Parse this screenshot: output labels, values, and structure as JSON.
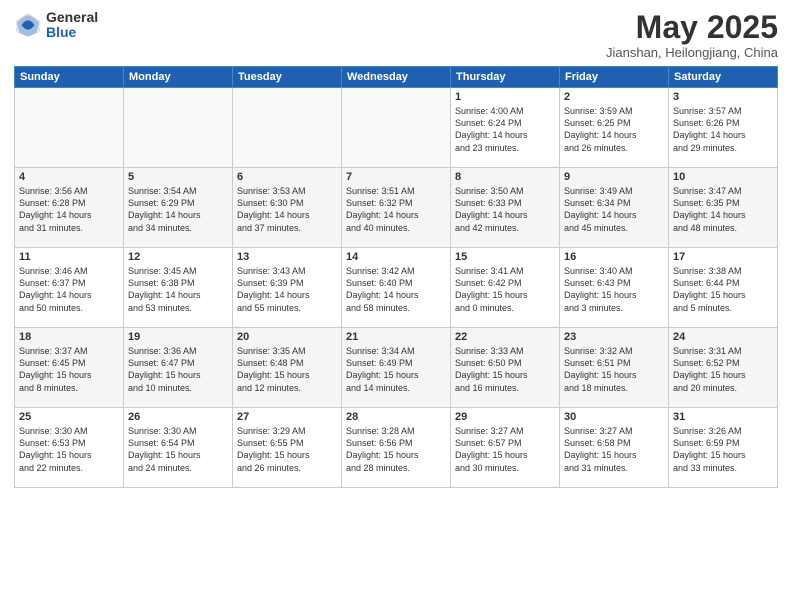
{
  "header": {
    "logo_general": "General",
    "logo_blue": "Blue",
    "title": "May 2025",
    "location": "Jianshan, Heilongjiang, China"
  },
  "weekdays": [
    "Sunday",
    "Monday",
    "Tuesday",
    "Wednesday",
    "Thursday",
    "Friday",
    "Saturday"
  ],
  "weeks": [
    [
      {
        "day": "",
        "info": ""
      },
      {
        "day": "",
        "info": ""
      },
      {
        "day": "",
        "info": ""
      },
      {
        "day": "",
        "info": ""
      },
      {
        "day": "1",
        "info": "Sunrise: 4:00 AM\nSunset: 6:24 PM\nDaylight: 14 hours\nand 23 minutes."
      },
      {
        "day": "2",
        "info": "Sunrise: 3:59 AM\nSunset: 6:25 PM\nDaylight: 14 hours\nand 26 minutes."
      },
      {
        "day": "3",
        "info": "Sunrise: 3:57 AM\nSunset: 6:26 PM\nDaylight: 14 hours\nand 29 minutes."
      }
    ],
    [
      {
        "day": "4",
        "info": "Sunrise: 3:56 AM\nSunset: 6:28 PM\nDaylight: 14 hours\nand 31 minutes."
      },
      {
        "day": "5",
        "info": "Sunrise: 3:54 AM\nSunset: 6:29 PM\nDaylight: 14 hours\nand 34 minutes."
      },
      {
        "day": "6",
        "info": "Sunrise: 3:53 AM\nSunset: 6:30 PM\nDaylight: 14 hours\nand 37 minutes."
      },
      {
        "day": "7",
        "info": "Sunrise: 3:51 AM\nSunset: 6:32 PM\nDaylight: 14 hours\nand 40 minutes."
      },
      {
        "day": "8",
        "info": "Sunrise: 3:50 AM\nSunset: 6:33 PM\nDaylight: 14 hours\nand 42 minutes."
      },
      {
        "day": "9",
        "info": "Sunrise: 3:49 AM\nSunset: 6:34 PM\nDaylight: 14 hours\nand 45 minutes."
      },
      {
        "day": "10",
        "info": "Sunrise: 3:47 AM\nSunset: 6:35 PM\nDaylight: 14 hours\nand 48 minutes."
      }
    ],
    [
      {
        "day": "11",
        "info": "Sunrise: 3:46 AM\nSunset: 6:37 PM\nDaylight: 14 hours\nand 50 minutes."
      },
      {
        "day": "12",
        "info": "Sunrise: 3:45 AM\nSunset: 6:38 PM\nDaylight: 14 hours\nand 53 minutes."
      },
      {
        "day": "13",
        "info": "Sunrise: 3:43 AM\nSunset: 6:39 PM\nDaylight: 14 hours\nand 55 minutes."
      },
      {
        "day": "14",
        "info": "Sunrise: 3:42 AM\nSunset: 6:40 PM\nDaylight: 14 hours\nand 58 minutes."
      },
      {
        "day": "15",
        "info": "Sunrise: 3:41 AM\nSunset: 6:42 PM\nDaylight: 15 hours\nand 0 minutes."
      },
      {
        "day": "16",
        "info": "Sunrise: 3:40 AM\nSunset: 6:43 PM\nDaylight: 15 hours\nand 3 minutes."
      },
      {
        "day": "17",
        "info": "Sunrise: 3:38 AM\nSunset: 6:44 PM\nDaylight: 15 hours\nand 5 minutes."
      }
    ],
    [
      {
        "day": "18",
        "info": "Sunrise: 3:37 AM\nSunset: 6:45 PM\nDaylight: 15 hours\nand 8 minutes."
      },
      {
        "day": "19",
        "info": "Sunrise: 3:36 AM\nSunset: 6:47 PM\nDaylight: 15 hours\nand 10 minutes."
      },
      {
        "day": "20",
        "info": "Sunrise: 3:35 AM\nSunset: 6:48 PM\nDaylight: 15 hours\nand 12 minutes."
      },
      {
        "day": "21",
        "info": "Sunrise: 3:34 AM\nSunset: 6:49 PM\nDaylight: 15 hours\nand 14 minutes."
      },
      {
        "day": "22",
        "info": "Sunrise: 3:33 AM\nSunset: 6:50 PM\nDaylight: 15 hours\nand 16 minutes."
      },
      {
        "day": "23",
        "info": "Sunrise: 3:32 AM\nSunset: 6:51 PM\nDaylight: 15 hours\nand 18 minutes."
      },
      {
        "day": "24",
        "info": "Sunrise: 3:31 AM\nSunset: 6:52 PM\nDaylight: 15 hours\nand 20 minutes."
      }
    ],
    [
      {
        "day": "25",
        "info": "Sunrise: 3:30 AM\nSunset: 6:53 PM\nDaylight: 15 hours\nand 22 minutes."
      },
      {
        "day": "26",
        "info": "Sunrise: 3:30 AM\nSunset: 6:54 PM\nDaylight: 15 hours\nand 24 minutes."
      },
      {
        "day": "27",
        "info": "Sunrise: 3:29 AM\nSunset: 6:55 PM\nDaylight: 15 hours\nand 26 minutes."
      },
      {
        "day": "28",
        "info": "Sunrise: 3:28 AM\nSunset: 6:56 PM\nDaylight: 15 hours\nand 28 minutes."
      },
      {
        "day": "29",
        "info": "Sunrise: 3:27 AM\nSunset: 6:57 PM\nDaylight: 15 hours\nand 30 minutes."
      },
      {
        "day": "30",
        "info": "Sunrise: 3:27 AM\nSunset: 6:58 PM\nDaylight: 15 hours\nand 31 minutes."
      },
      {
        "day": "31",
        "info": "Sunrise: 3:26 AM\nSunset: 6:59 PM\nDaylight: 15 hours\nand 33 minutes."
      }
    ]
  ]
}
